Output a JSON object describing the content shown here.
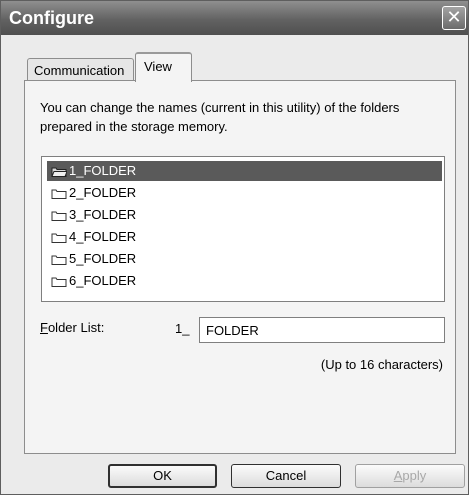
{
  "window": {
    "title": "Configure",
    "close_glyph": "✕"
  },
  "tabs": [
    {
      "label": "Communication",
      "selected": false
    },
    {
      "label": "View",
      "selected": true
    }
  ],
  "description": "You can change the names (current in this utility) of the folders prepared in the storage memory.",
  "folders": [
    {
      "label": "1_FOLDER",
      "selected": true,
      "icon": "open-folder-icon"
    },
    {
      "label": "2_FOLDER",
      "selected": false,
      "icon": "folder-icon"
    },
    {
      "label": "3_FOLDER",
      "selected": false,
      "icon": "folder-icon"
    },
    {
      "label": "4_FOLDER",
      "selected": false,
      "icon": "folder-icon"
    },
    {
      "label": "5_FOLDER",
      "selected": false,
      "icon": "folder-icon"
    },
    {
      "label": "6_FOLDER",
      "selected": false,
      "icon": "folder-icon"
    }
  ],
  "folder_list": {
    "label_accel": "F",
    "label_rest": "older List:",
    "prefix": "1_",
    "value": "FOLDER",
    "hint": "(Up to 16 characters)"
  },
  "buttons": {
    "ok": "OK",
    "cancel": "Cancel",
    "apply_accel": "A",
    "apply_rest": "pply",
    "apply_enabled": false
  }
}
